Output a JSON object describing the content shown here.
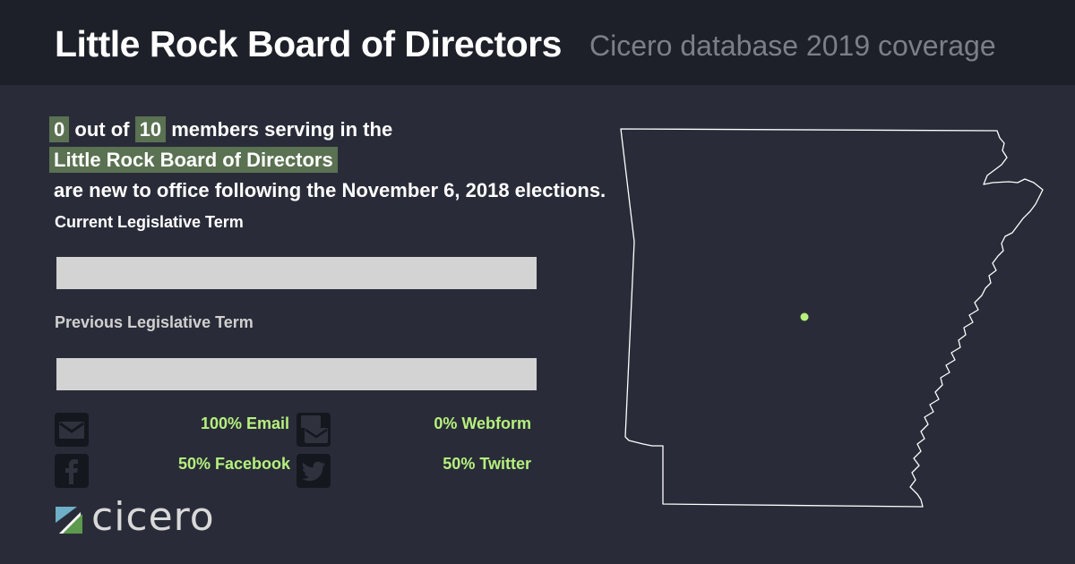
{
  "header": {
    "title": "Little Rock Board of Directors",
    "subtitle": "Cicero database 2019 coverage"
  },
  "summary": {
    "new_count": "0",
    "text_out_of": "out of",
    "total_count": "10",
    "text_members": "members serving in the",
    "body_name": "Little Rock Board of Directors",
    "text_rest": "are new to office following the November 6, 2018 elections."
  },
  "terms": {
    "current_label": "Current Legislative Term",
    "previous_label": "Previous Legislative Term"
  },
  "contact_stats": {
    "email": "100% Email",
    "webform": "0% Webform",
    "facebook": "50% Facebook",
    "twitter": "50% Twitter"
  },
  "icons": [
    "envelope-icon",
    "webform-icon",
    "facebook-icon",
    "twitter-icon"
  ],
  "logo": {
    "text": "cicero"
  },
  "colors": {
    "background": "#292c38",
    "header_bg": "#1d2029",
    "highlight": "#5a7152",
    "stat_green": "#b6f07e",
    "bar_gray": "#d3d3d3",
    "map_point": "#b6f07e"
  }
}
